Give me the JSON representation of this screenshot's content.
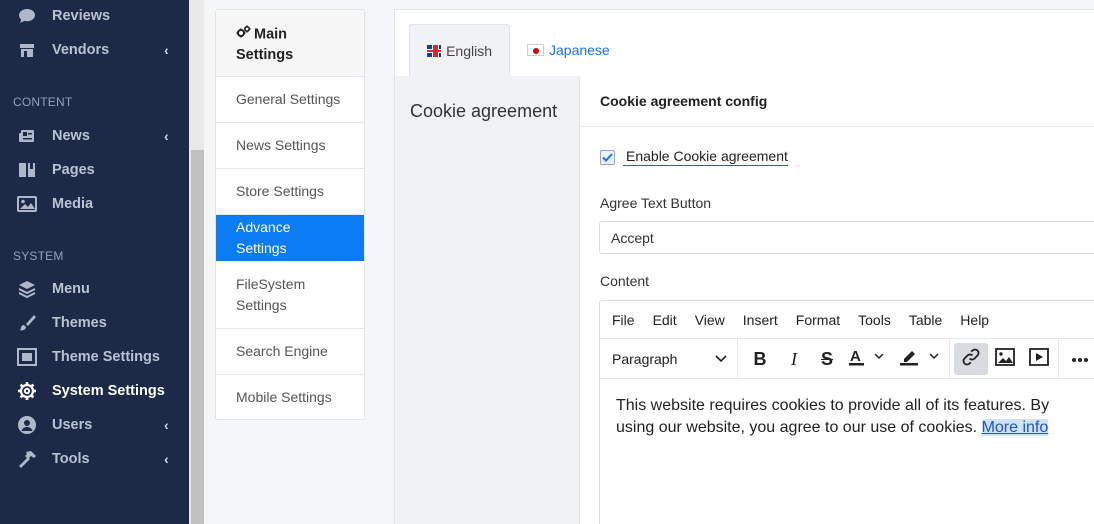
{
  "sidebar": {
    "items_top": [
      {
        "label": "Reviews",
        "icon": "comment-icon"
      },
      {
        "label": "Vendors",
        "icon": "store-icon",
        "chevron": "‹"
      }
    ],
    "section_content": "CONTENT",
    "items_content": [
      {
        "label": "News",
        "icon": "news-icon",
        "chevron": "‹"
      },
      {
        "label": "Pages",
        "icon": "pages-icon"
      },
      {
        "label": "Media",
        "icon": "image-icon"
      }
    ],
    "section_system": "SYSTEM",
    "items_system": [
      {
        "label": "Menu",
        "icon": "layers-icon"
      },
      {
        "label": "Themes",
        "icon": "brush-icon"
      },
      {
        "label": "Theme Settings",
        "icon": "theme-settings-icon"
      },
      {
        "label": "System Settings",
        "icon": "gear-icon"
      },
      {
        "label": "Users",
        "icon": "users-icon",
        "chevron": "‹"
      },
      {
        "label": "Tools",
        "icon": "hammer-icon",
        "chevron": "‹"
      }
    ]
  },
  "settings_menu": {
    "title": "Main Settings",
    "items": [
      "General Settings",
      "News Settings",
      "Store Settings",
      "Advance Settings",
      "FileSystem Settings",
      "Search Engine",
      "Mobile Settings"
    ],
    "active": "Advance Settings"
  },
  "tabs": {
    "english": "English",
    "japanese": "Japanese"
  },
  "section": {
    "title": "Cookie agreement"
  },
  "card": {
    "title": "Cookie agreement config",
    "enable_label": "Enable Cookie agreement",
    "enable_checked": true,
    "agree_label": "Agree Text Button",
    "agree_value": "Accept",
    "content_label": "Content"
  },
  "editor": {
    "menu": [
      "File",
      "Edit",
      "View",
      "Insert",
      "Format",
      "Tools",
      "Table",
      "Help"
    ],
    "block_format": "Paragraph",
    "body_text": "This website requires cookies to provide all of its features. By using our website, you agree to our use of cookies.",
    "link_text": "More info"
  },
  "colors": {
    "sidebar_bg": "#1c2a47",
    "accent": "#0b7cf4",
    "link": "#1a73e8"
  }
}
